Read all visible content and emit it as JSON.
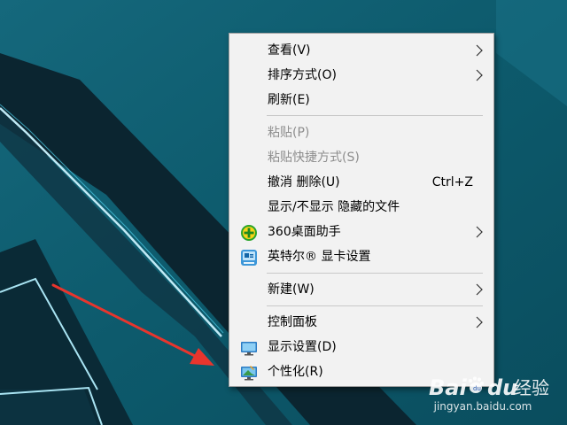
{
  "menu": {
    "items": [
      {
        "label": "查看(V)",
        "submenu": true
      },
      {
        "label": "排序方式(O)",
        "submenu": true
      },
      {
        "label": "刷新(E)"
      },
      {
        "label": "粘贴(P)",
        "disabled": true
      },
      {
        "label": "粘贴快捷方式(S)",
        "disabled": true
      },
      {
        "label": "撤消 删除(U)",
        "shortcut": "Ctrl+Z"
      },
      {
        "label": "显示/不显示 隐藏的文件"
      },
      {
        "label": "360桌面助手",
        "icon": "360-desktop-icon",
        "submenu": true
      },
      {
        "label": "英特尔® 显卡设置",
        "icon": "intel-graphics-icon"
      },
      {
        "label": "新建(W)",
        "submenu": true
      },
      {
        "label": "控制面板",
        "submenu": true
      },
      {
        "label": "显示设置(D)",
        "icon": "display-settings-icon"
      },
      {
        "label": "个性化(R)",
        "icon": "personalize-icon"
      }
    ]
  },
  "watermark": {
    "brand": "Bai",
    "brand2": "du",
    "cn": "经验",
    "site": "jingyan.baidu.com"
  },
  "colors": {
    "desktop_bg": "#0d5a6c",
    "menu_bg": "#f2f2f2",
    "disabled_text": "#8d8d8d",
    "arrow": "#e8352d"
  }
}
